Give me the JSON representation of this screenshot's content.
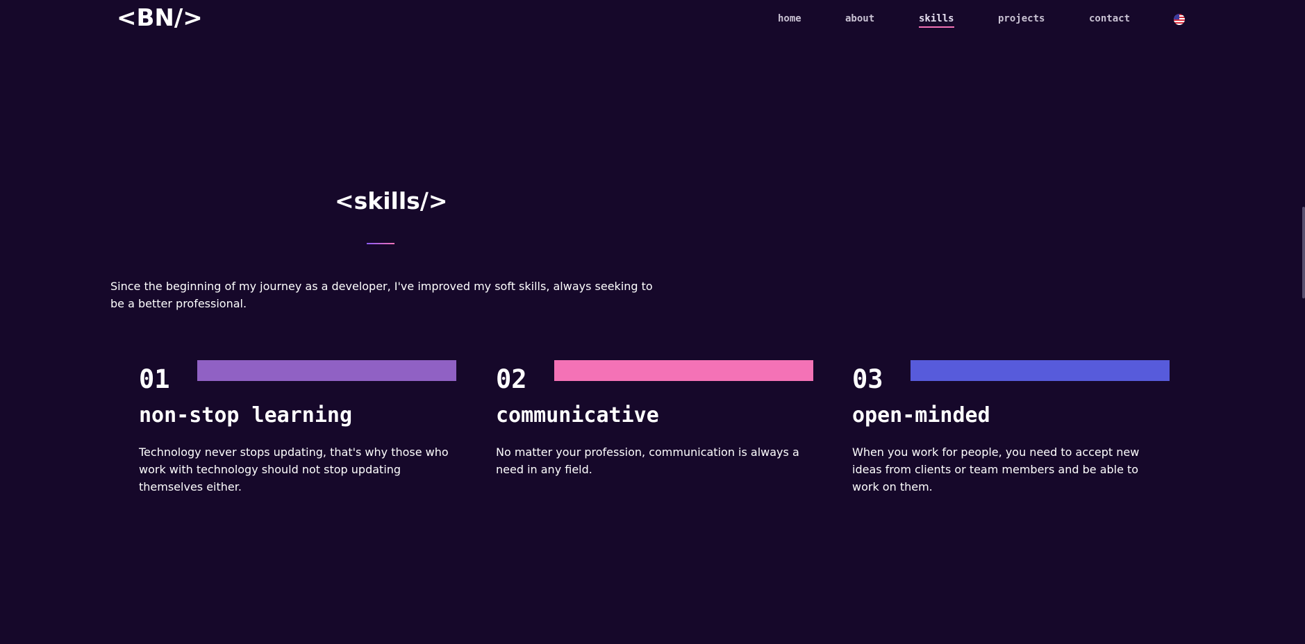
{
  "header": {
    "logo": "<BN/>",
    "nav": [
      {
        "label": "home",
        "active": false
      },
      {
        "label": "about",
        "active": false
      },
      {
        "label": "skills",
        "active": true
      },
      {
        "label": "projects",
        "active": false
      },
      {
        "label": "contact",
        "active": false
      }
    ],
    "language_icon": "us-flag-icon"
  },
  "skills": {
    "title": "<skills/>",
    "intro": "Since the beginning of my journey as a developer, I've improved my soft skills, always seeking to be a better professional.",
    "cards": [
      {
        "number": "01",
        "title": "non-stop learning",
        "text": "Technology never stops updating, that's why those who work with technology should not stop updating themselves either.",
        "color": "#9061c4"
      },
      {
        "number": "02",
        "title": "communicative",
        "text": "No matter your profession, communication is always a need in any field.",
        "color": "#f472b6"
      },
      {
        "number": "03",
        "title": "open-minded",
        "text": "When you work for people, you need to accept new ideas from clients or team members and be able to work on them.",
        "color": "#575bdb"
      }
    ]
  },
  "colors": {
    "background": "#16082a",
    "accent": "#f472b6"
  }
}
